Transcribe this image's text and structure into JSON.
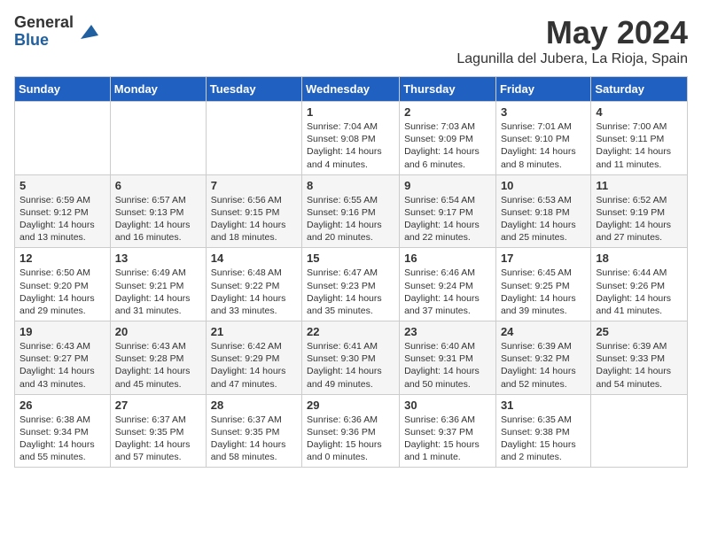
{
  "logo": {
    "general": "General",
    "blue": "Blue"
  },
  "title": "May 2024",
  "location": "Lagunilla del Jubera, La Rioja, Spain",
  "headers": [
    "Sunday",
    "Monday",
    "Tuesday",
    "Wednesday",
    "Thursday",
    "Friday",
    "Saturday"
  ],
  "weeks": [
    [
      {
        "day": "",
        "sunrise": "",
        "sunset": "",
        "daylight": ""
      },
      {
        "day": "",
        "sunrise": "",
        "sunset": "",
        "daylight": ""
      },
      {
        "day": "",
        "sunrise": "",
        "sunset": "",
        "daylight": ""
      },
      {
        "day": "1",
        "sunrise": "Sunrise: 7:04 AM",
        "sunset": "Sunset: 9:08 PM",
        "daylight": "Daylight: 14 hours and 4 minutes."
      },
      {
        "day": "2",
        "sunrise": "Sunrise: 7:03 AM",
        "sunset": "Sunset: 9:09 PM",
        "daylight": "Daylight: 14 hours and 6 minutes."
      },
      {
        "day": "3",
        "sunrise": "Sunrise: 7:01 AM",
        "sunset": "Sunset: 9:10 PM",
        "daylight": "Daylight: 14 hours and 8 minutes."
      },
      {
        "day": "4",
        "sunrise": "Sunrise: 7:00 AM",
        "sunset": "Sunset: 9:11 PM",
        "daylight": "Daylight: 14 hours and 11 minutes."
      }
    ],
    [
      {
        "day": "5",
        "sunrise": "Sunrise: 6:59 AM",
        "sunset": "Sunset: 9:12 PM",
        "daylight": "Daylight: 14 hours and 13 minutes."
      },
      {
        "day": "6",
        "sunrise": "Sunrise: 6:57 AM",
        "sunset": "Sunset: 9:13 PM",
        "daylight": "Daylight: 14 hours and 16 minutes."
      },
      {
        "day": "7",
        "sunrise": "Sunrise: 6:56 AM",
        "sunset": "Sunset: 9:15 PM",
        "daylight": "Daylight: 14 hours and 18 minutes."
      },
      {
        "day": "8",
        "sunrise": "Sunrise: 6:55 AM",
        "sunset": "Sunset: 9:16 PM",
        "daylight": "Daylight: 14 hours and 20 minutes."
      },
      {
        "day": "9",
        "sunrise": "Sunrise: 6:54 AM",
        "sunset": "Sunset: 9:17 PM",
        "daylight": "Daylight: 14 hours and 22 minutes."
      },
      {
        "day": "10",
        "sunrise": "Sunrise: 6:53 AM",
        "sunset": "Sunset: 9:18 PM",
        "daylight": "Daylight: 14 hours and 25 minutes."
      },
      {
        "day": "11",
        "sunrise": "Sunrise: 6:52 AM",
        "sunset": "Sunset: 9:19 PM",
        "daylight": "Daylight: 14 hours and 27 minutes."
      }
    ],
    [
      {
        "day": "12",
        "sunrise": "Sunrise: 6:50 AM",
        "sunset": "Sunset: 9:20 PM",
        "daylight": "Daylight: 14 hours and 29 minutes."
      },
      {
        "day": "13",
        "sunrise": "Sunrise: 6:49 AM",
        "sunset": "Sunset: 9:21 PM",
        "daylight": "Daylight: 14 hours and 31 minutes."
      },
      {
        "day": "14",
        "sunrise": "Sunrise: 6:48 AM",
        "sunset": "Sunset: 9:22 PM",
        "daylight": "Daylight: 14 hours and 33 minutes."
      },
      {
        "day": "15",
        "sunrise": "Sunrise: 6:47 AM",
        "sunset": "Sunset: 9:23 PM",
        "daylight": "Daylight: 14 hours and 35 minutes."
      },
      {
        "day": "16",
        "sunrise": "Sunrise: 6:46 AM",
        "sunset": "Sunset: 9:24 PM",
        "daylight": "Daylight: 14 hours and 37 minutes."
      },
      {
        "day": "17",
        "sunrise": "Sunrise: 6:45 AM",
        "sunset": "Sunset: 9:25 PM",
        "daylight": "Daylight: 14 hours and 39 minutes."
      },
      {
        "day": "18",
        "sunrise": "Sunrise: 6:44 AM",
        "sunset": "Sunset: 9:26 PM",
        "daylight": "Daylight: 14 hours and 41 minutes."
      }
    ],
    [
      {
        "day": "19",
        "sunrise": "Sunrise: 6:43 AM",
        "sunset": "Sunset: 9:27 PM",
        "daylight": "Daylight: 14 hours and 43 minutes."
      },
      {
        "day": "20",
        "sunrise": "Sunrise: 6:43 AM",
        "sunset": "Sunset: 9:28 PM",
        "daylight": "Daylight: 14 hours and 45 minutes."
      },
      {
        "day": "21",
        "sunrise": "Sunrise: 6:42 AM",
        "sunset": "Sunset: 9:29 PM",
        "daylight": "Daylight: 14 hours and 47 minutes."
      },
      {
        "day": "22",
        "sunrise": "Sunrise: 6:41 AM",
        "sunset": "Sunset: 9:30 PM",
        "daylight": "Daylight: 14 hours and 49 minutes."
      },
      {
        "day": "23",
        "sunrise": "Sunrise: 6:40 AM",
        "sunset": "Sunset: 9:31 PM",
        "daylight": "Daylight: 14 hours and 50 minutes."
      },
      {
        "day": "24",
        "sunrise": "Sunrise: 6:39 AM",
        "sunset": "Sunset: 9:32 PM",
        "daylight": "Daylight: 14 hours and 52 minutes."
      },
      {
        "day": "25",
        "sunrise": "Sunrise: 6:39 AM",
        "sunset": "Sunset: 9:33 PM",
        "daylight": "Daylight: 14 hours and 54 minutes."
      }
    ],
    [
      {
        "day": "26",
        "sunrise": "Sunrise: 6:38 AM",
        "sunset": "Sunset: 9:34 PM",
        "daylight": "Daylight: 14 hours and 55 minutes."
      },
      {
        "day": "27",
        "sunrise": "Sunrise: 6:37 AM",
        "sunset": "Sunset: 9:35 PM",
        "daylight": "Daylight: 14 hours and 57 minutes."
      },
      {
        "day": "28",
        "sunrise": "Sunrise: 6:37 AM",
        "sunset": "Sunset: 9:35 PM",
        "daylight": "Daylight: 14 hours and 58 minutes."
      },
      {
        "day": "29",
        "sunrise": "Sunrise: 6:36 AM",
        "sunset": "Sunset: 9:36 PM",
        "daylight": "Daylight: 15 hours and 0 minutes."
      },
      {
        "day": "30",
        "sunrise": "Sunrise: 6:36 AM",
        "sunset": "Sunset: 9:37 PM",
        "daylight": "Daylight: 15 hours and 1 minute."
      },
      {
        "day": "31",
        "sunrise": "Sunrise: 6:35 AM",
        "sunset": "Sunset: 9:38 PM",
        "daylight": "Daylight: 15 hours and 2 minutes."
      },
      {
        "day": "",
        "sunrise": "",
        "sunset": "",
        "daylight": ""
      }
    ]
  ]
}
